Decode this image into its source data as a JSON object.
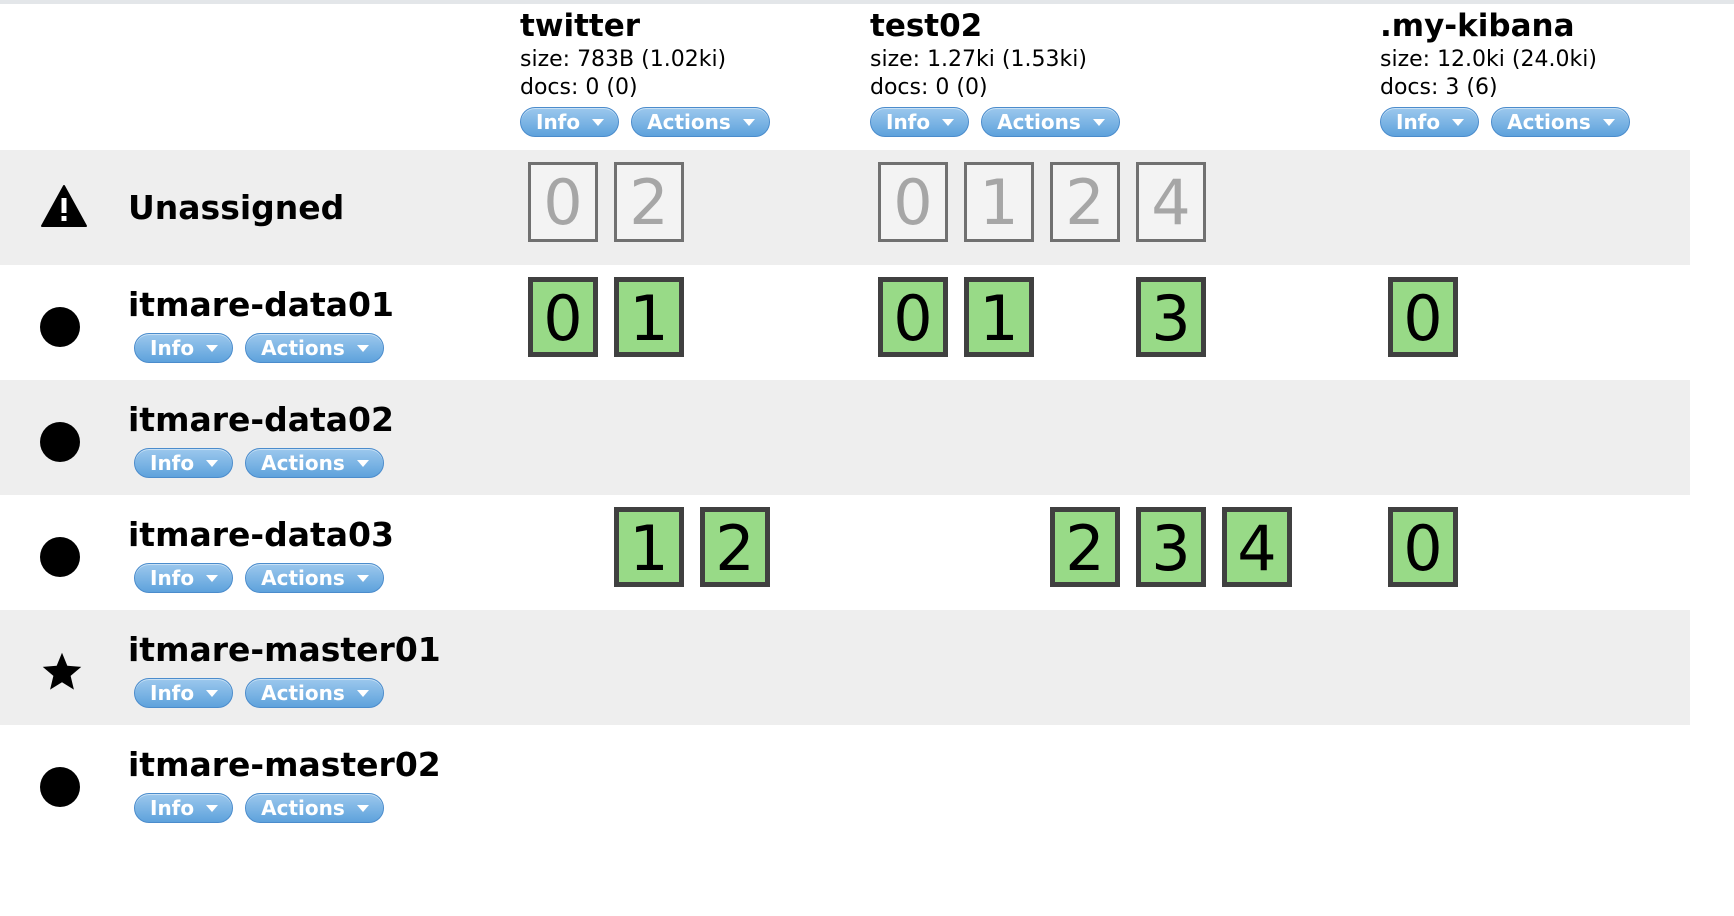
{
  "indices": [
    {
      "name": "twitter",
      "size": "size: 783B (1.02ki)",
      "docs": "docs: 0 (0)",
      "info_label": "Info",
      "actions_label": "Actions"
    },
    {
      "name": "test02",
      "size": "size: 1.27ki (1.53ki)",
      "docs": "docs: 0 (0)",
      "info_label": "Info",
      "actions_label": "Actions"
    },
    {
      "name": ".my-kibana",
      "size": "size: 12.0ki (24.0ki)",
      "docs": "docs: 3 (6)",
      "info_label": "Info",
      "actions_label": "Actions"
    }
  ],
  "rows": [
    {
      "name": "Unassigned",
      "icon": "warning-icon"
    },
    {
      "name": "itmare-data01",
      "icon": "dot-icon",
      "info_label": "Info",
      "actions_label": "Actions"
    },
    {
      "name": "itmare-data02",
      "icon": "dot-icon",
      "info_label": "Info",
      "actions_label": "Actions"
    },
    {
      "name": "itmare-data03",
      "icon": "dot-icon",
      "info_label": "Info",
      "actions_label": "Actions"
    },
    {
      "name": "itmare-master01",
      "icon": "star-icon",
      "info_label": "Info",
      "actions_label": "Actions"
    },
    {
      "name": "itmare-master02",
      "icon": "dot-icon",
      "info_label": "Info",
      "actions_label": "Actions"
    }
  ],
  "shards": {
    "unassigned": {
      "twitter": [
        "0",
        "2"
      ],
      "test02": [
        "0",
        "1",
        "2",
        "4"
      ]
    },
    "itmare_data01": {
      "twitter": [
        "0",
        "1"
      ],
      "test02": [
        "0",
        "1",
        "3"
      ],
      "my_kibana": [
        "0"
      ]
    },
    "itmare_data03": {
      "twitter": [
        "1",
        "2"
      ],
      "test02": [
        "2",
        "3",
        "4"
      ],
      "my_kibana": [
        "0"
      ]
    }
  },
  "colors": {
    "assigned_shard": "#98da87",
    "unassigned_shard": "#f3f3f3",
    "button": "#5ea2dc",
    "row_shade": "#eeeeee"
  }
}
